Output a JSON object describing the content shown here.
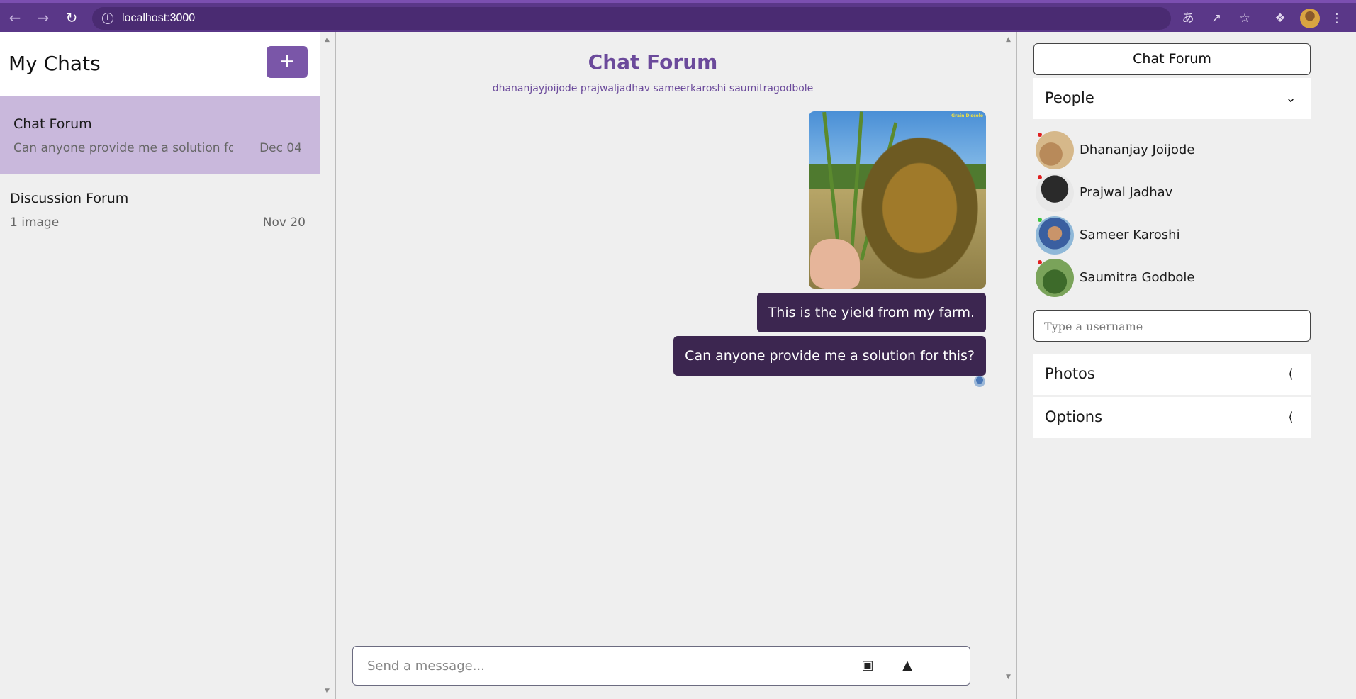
{
  "browser": {
    "url": "localhost:3000",
    "back_icon": "arrow-left-icon",
    "forward_icon": "arrow-right-icon",
    "reload_icon": "reload-icon",
    "info_icon": "info-icon",
    "translate_icon": "translate-icon",
    "share_icon": "share-icon",
    "bookmark_icon": "star-icon",
    "extensions_icon": "puzzle-icon",
    "menu_icon": "kebab-menu-icon",
    "accent_color": "#5a3788"
  },
  "sidebar": {
    "title": "My Chats",
    "add_label": "+",
    "chats": [
      {
        "name": "Chat Forum",
        "preview": "Can anyone provide me a solution fo",
        "date": "Dec 04",
        "selected": true
      },
      {
        "name": "Discussion Forum",
        "preview": "1 image",
        "date": "Nov 20",
        "selected": false
      }
    ]
  },
  "chat": {
    "title": "Chat Forum",
    "members": "dhananjayjoijode prajwaljadhav sameerkaroshi saumitragodbole",
    "image_watermark": "Grain Discolo",
    "messages": [
      "This is the yield from my farm.",
      "Can anyone provide me a solution for this?"
    ],
    "composer_placeholder": "Send a message...",
    "attach_icon": "image-icon",
    "send_icon": "send-icon",
    "bubble_color": "#3c2650",
    "title_color": "#6b4a9b"
  },
  "details": {
    "title": "Chat Forum",
    "people_label": "People",
    "people": [
      {
        "name": "Dhananjay Joijode",
        "status": "offline",
        "status_color": "#e02020"
      },
      {
        "name": "Prajwal Jadhav",
        "status": "offline",
        "status_color": "#e02020"
      },
      {
        "name": "Sameer Karoshi",
        "status": "online",
        "status_color": "#3cc43c"
      },
      {
        "name": "Saumitra Godbole",
        "status": "offline",
        "status_color": "#e02020"
      }
    ],
    "username_placeholder": "Type a username",
    "photos_label": "Photos",
    "options_label": "Options"
  }
}
